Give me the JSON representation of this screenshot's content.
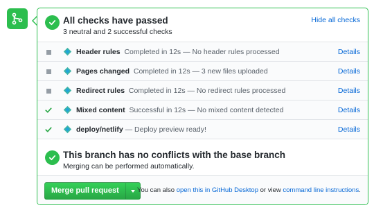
{
  "header": {
    "title": "All checks have passed",
    "subtitle": "3 neutral and 2 successful checks",
    "hide_link": "Hide all checks"
  },
  "checks": [
    {
      "status": "neutral",
      "name": "Header rules",
      "description": "Completed in 12s — No header rules processed",
      "action": "Details"
    },
    {
      "status": "neutral",
      "name": "Pages changed",
      "description": "Completed in 12s — 3 new files uploaded",
      "action": "Details"
    },
    {
      "status": "neutral",
      "name": "Redirect rules",
      "description": "Completed in 12s — No redirect rules processed",
      "action": "Details"
    },
    {
      "status": "success",
      "name": "Mixed content",
      "description": "Successful in 12s — No mixed content detected",
      "action": "Details"
    },
    {
      "status": "success",
      "name": "deploy/netlify",
      "description": "— Deploy preview ready!",
      "action": "Details"
    }
  ],
  "conflicts": {
    "title": "This branch has no conflicts with the base branch",
    "subtitle": "Merging can be performed automatically."
  },
  "footer": {
    "merge_button": "Merge pull request",
    "text_prefix": "You can also",
    "desktop_link": "open this in GitHub Desktop",
    "text_middle": "or view",
    "cli_link": "command line instructions",
    "text_suffix": "."
  },
  "colors": {
    "success": "#2cbe4e",
    "neutral": "#959da5",
    "link": "#0366d6"
  },
  "icons": {
    "merge": "git-merge-icon",
    "check": "check-icon",
    "neutral": "neutral-square-icon",
    "app": "netlify-icon"
  }
}
